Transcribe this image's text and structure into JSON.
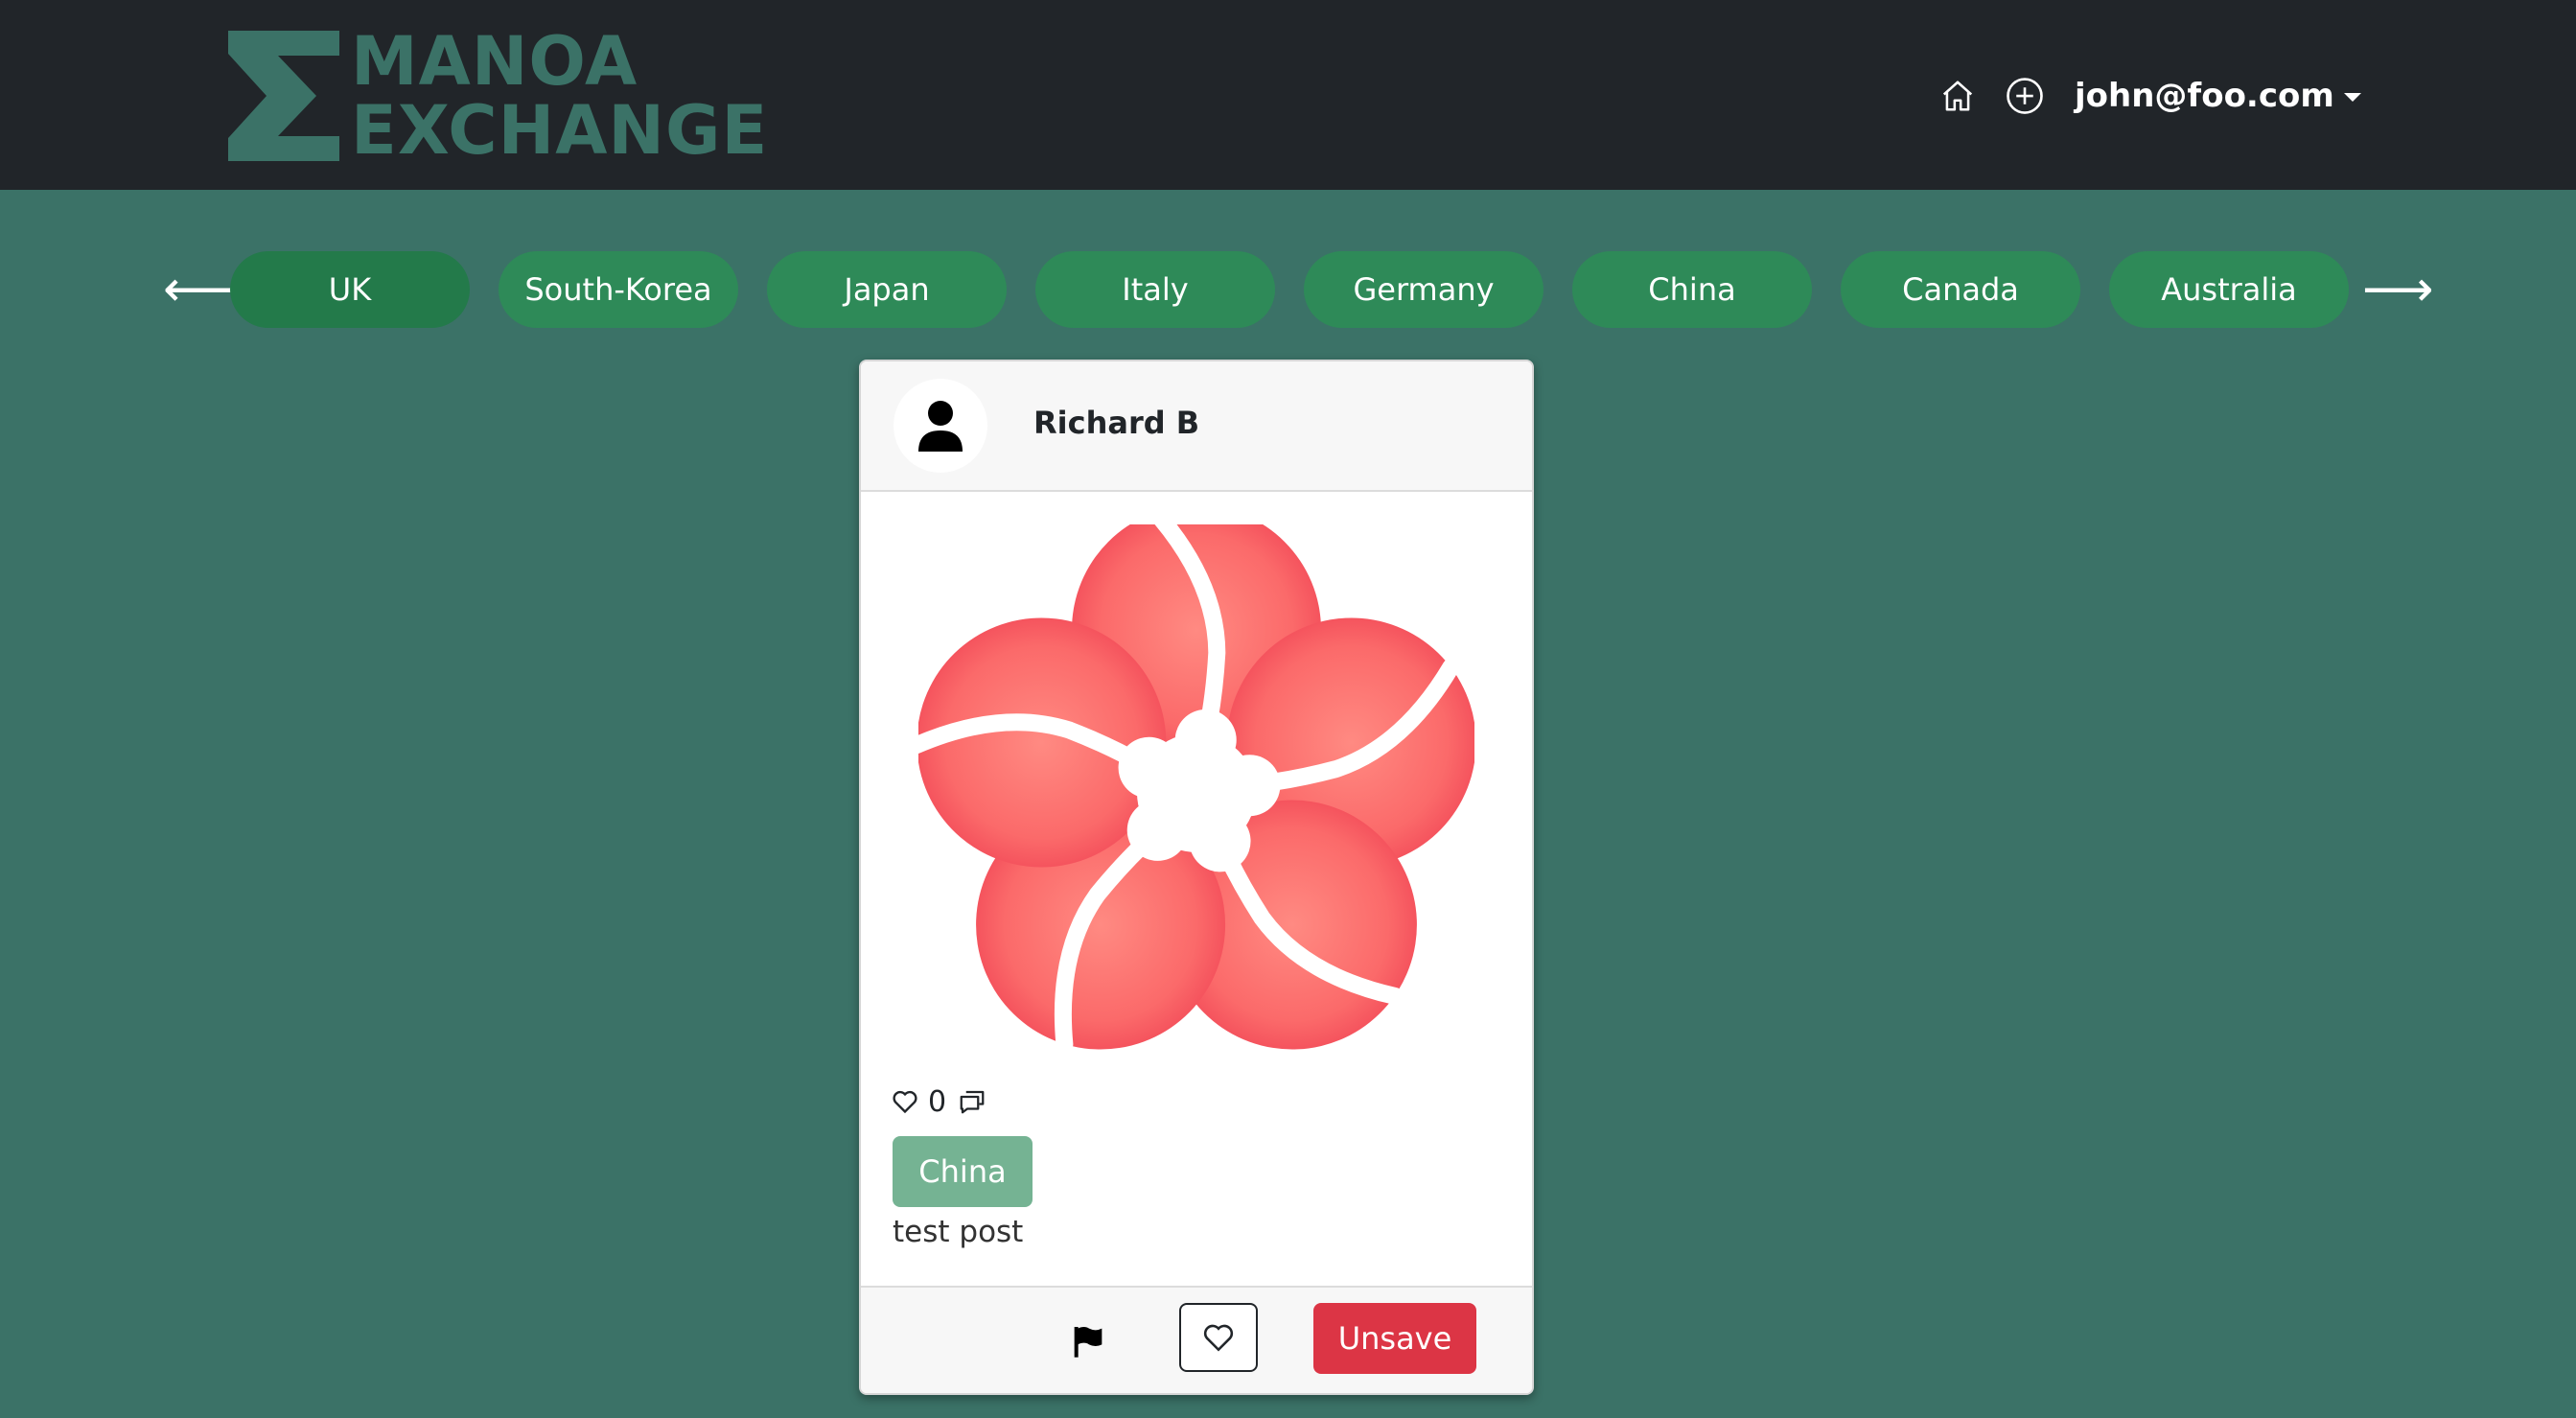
{
  "navbar": {
    "brand_line1": "MANOA",
    "brand_line2": "EXCHANGE",
    "user_email": "john@foo.com",
    "home_icon": "home-icon",
    "add_icon": "plus-circle-icon"
  },
  "filter": {
    "prev_arrow": "⟵",
    "next_arrow": "⟶",
    "countries": [
      "UK",
      "South-Korea",
      "Japan",
      "Italy",
      "Germany",
      "China",
      "Canada",
      "Australia"
    ],
    "active": "UK"
  },
  "post": {
    "author": "Richard B",
    "likes": "0",
    "tag": "China",
    "text": "test post",
    "unsave_label": "Unsave"
  },
  "colors": {
    "navbar_bg": "#212529",
    "page_bg": "#3b7267",
    "chip": "#2e8a58",
    "tag": "#75b393",
    "danger": "#dc3545"
  }
}
